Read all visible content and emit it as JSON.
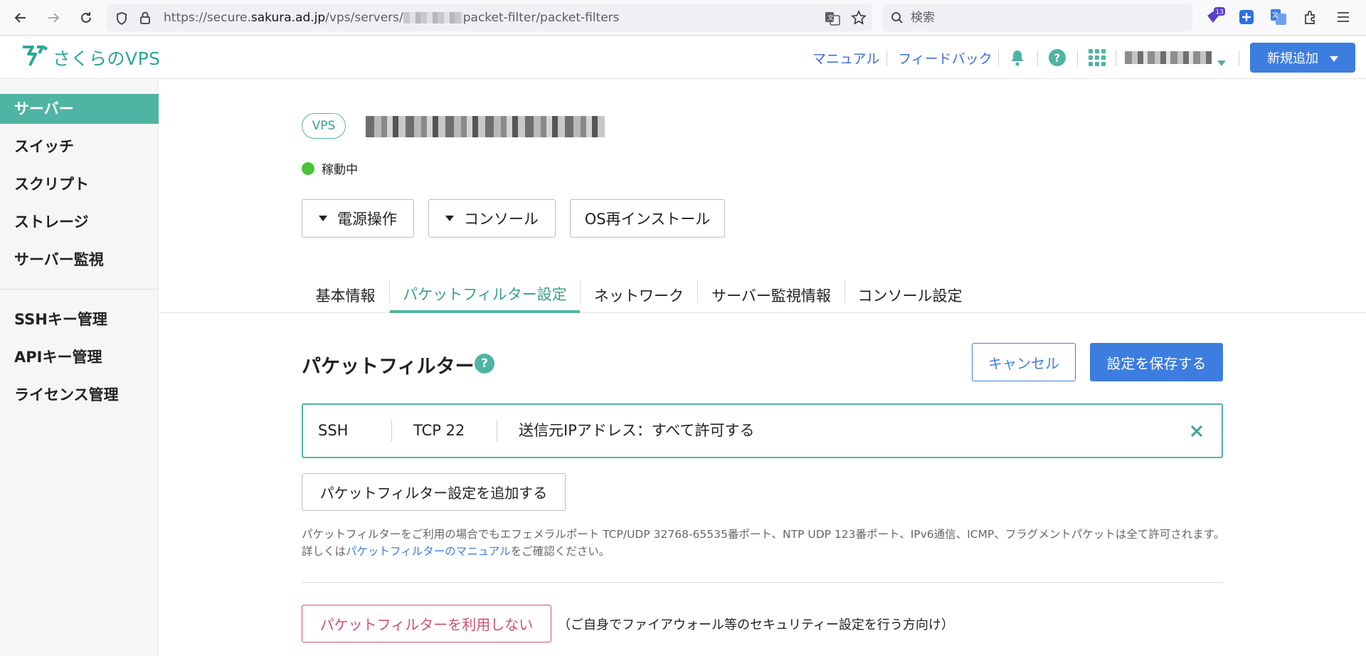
{
  "browser": {
    "url_prefix": "https://secure.",
    "url_domain": "sakura.ad.jp",
    "url_path_start": "/vps/servers/",
    "url_path_end": "packet-filter/packet-filters",
    "search_placeholder": "検索",
    "extension_badge": "13"
  },
  "header": {
    "logo_text": "さくらのVPS",
    "links": [
      "マニュアル",
      "フィードバック"
    ],
    "new_button": "新規追加",
    "accent": "#4fb4a3",
    "primary": "#3d7de0"
  },
  "sidebar": {
    "items": [
      "サーバー",
      "スイッチ",
      "スクリプト",
      "ストレージ",
      "サーバー監視"
    ],
    "items2": [
      "SSHキー管理",
      "APIキー管理",
      "ライセンス管理"
    ],
    "active": "サーバー"
  },
  "server": {
    "badge": "VPS",
    "status": "稼動中",
    "status_color": "#4cc13a"
  },
  "actions": {
    "power": "電源操作",
    "console": "コンソール",
    "reinstall": "OS再インストール"
  },
  "tabs": [
    "基本情報",
    "パケットフィルター設定",
    "ネットワーク",
    "サーバー監視情報",
    "コンソール設定"
  ],
  "packet_filter": {
    "title": "パケットフィルター",
    "help": "?",
    "cancel": "キャンセル",
    "save": "設定を保存する",
    "rule": {
      "service": "SSH",
      "protocol": "TCP 22",
      "source": "送信元IPアドレス：すべて許可する"
    },
    "add_button": "パケットフィルター設定を追加する",
    "note_before": "パケットフィルターをご利用の場合でもエフェメラルポート TCP/UDP 32768-65535番ポート、NTP UDP 123番ポート、IPv6通信、ICMP、フラグメントパケットは全て許可されます。詳しくは",
    "note_link": "パケットフィルターのマニュアル",
    "note_after": "をご確認ください。",
    "disable_button": "パケットフィルターを利用しない",
    "disable_note": "（ご自身でファイアウォール等のセキュリティー設定を行う方向け）"
  }
}
